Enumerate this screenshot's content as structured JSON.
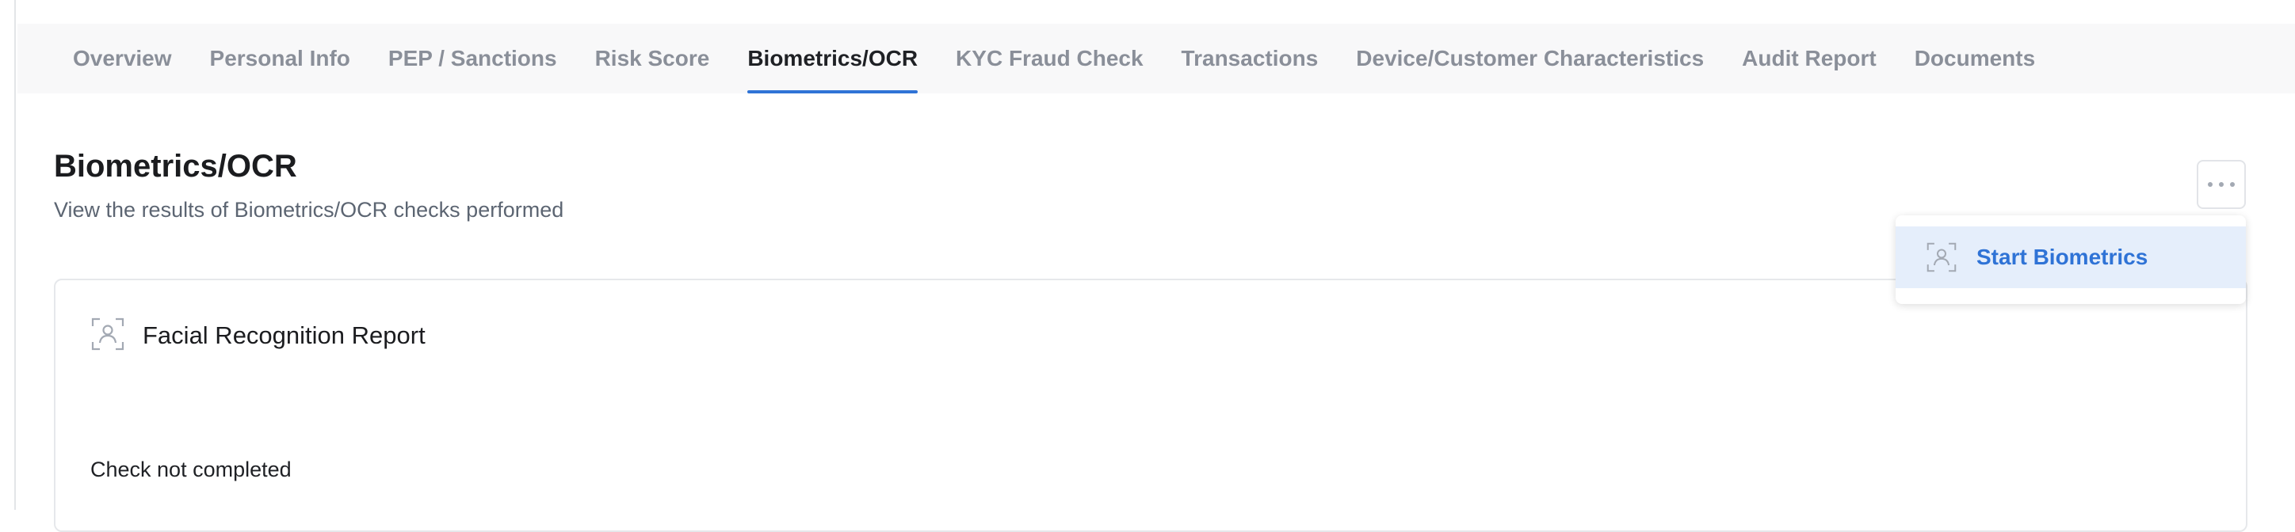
{
  "tabs": [
    {
      "label": "Overview"
    },
    {
      "label": "Personal Info"
    },
    {
      "label": "PEP / Sanctions"
    },
    {
      "label": "Risk Score"
    },
    {
      "label": "Biometrics/OCR",
      "active": true
    },
    {
      "label": "KYC Fraud Check"
    },
    {
      "label": "Transactions"
    },
    {
      "label": "Device/Customer Characteristics"
    },
    {
      "label": "Audit Report"
    },
    {
      "label": "Documents"
    }
  ],
  "header": {
    "title": "Biometrics/OCR",
    "subtitle": "View the results of Biometrics/OCR checks performed"
  },
  "actions": {
    "more_icon": "more-horizontal-icon",
    "menu": [
      {
        "label": "Start Biometrics",
        "icon": "face-scan-icon"
      }
    ]
  },
  "facial_card": {
    "icon": "face-scan-icon",
    "title": "Facial Recognition Report",
    "status": "Check not completed"
  },
  "colors": {
    "accent": "#2f73d6",
    "tab_inactive": "#8a8f99",
    "menu_highlight": "#e5eefb"
  }
}
